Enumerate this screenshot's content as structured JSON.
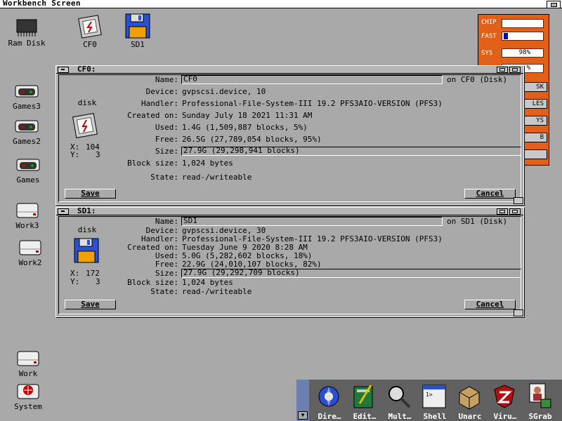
{
  "screen": {
    "title": "Workbench Screen"
  },
  "desktop_icons": [
    {
      "label": "Ram Disk"
    },
    {
      "label": "CF0"
    },
    {
      "label": "SD1"
    },
    {
      "label": "Games3"
    },
    {
      "label": "Games2"
    },
    {
      "label": "Games"
    },
    {
      "label": "Work3"
    },
    {
      "label": "Work2"
    },
    {
      "label": "Work"
    },
    {
      "label": "System"
    }
  ],
  "monitor": {
    "chip_label": "CHIP",
    "fast_label": "FAST",
    "sys_label": "SYS",
    "sys_value": "98%",
    "cpu_value": "%",
    "chip_fill": 0.0,
    "fast_fill": 0.12,
    "buttons": [
      "SK",
      "LES",
      "YS",
      "B",
      ""
    ]
  },
  "windows": [
    {
      "title": "CF0:",
      "icon_label": "disk",
      "x_label": "X:",
      "x_value": "104",
      "y_label": "Y:",
      "y_value": "3",
      "labels": {
        "name": "Name:",
        "device": "Device:",
        "handler": "Handler:",
        "created": "Created on:",
        "used": "Used:",
        "free": "Free:",
        "size": "Size:",
        "block": "Block size:",
        "state": "State:"
      },
      "name": "CF0",
      "on_text": "on CF0 (Disk)",
      "device": "gvpscsi.device, 10",
      "handler": "Professional-File-System-III 19.2 PFS3AIO-VERSION  (PFS3)",
      "created": "Sunday July 18 2021 11:31 AM",
      "used": "1.4G (1,509,887 blocks, 5%)",
      "free": "26.5G (27,789,054 blocks, 95%)",
      "size": "27.9G (29,298,941 blocks)",
      "block": "1,024 bytes",
      "state": "read-/writeable",
      "save": "Save",
      "cancel": "Cancel"
    },
    {
      "title": "SD1:",
      "icon_label": "disk",
      "x_label": "X:",
      "x_value": "172",
      "y_label": "Y:",
      "y_value": "3",
      "labels": {
        "name": "Name:",
        "device": "Device:",
        "handler": "Handler:",
        "created": "Created on:",
        "used": "Used:",
        "free": "Free:",
        "size": "Size:",
        "block": "Block size:",
        "state": "State:"
      },
      "name": "SD1",
      "on_text": "on SD1 (Disk)",
      "device": "gvpscsi.device, 30",
      "handler": "Professional-File-System-III 19.2 PFS3AIO-VERSION  (PFS3)",
      "created": "Tuesday June  9 2020 8:28 AM",
      "used": "5.0G (5,282,602 blocks, 18%)",
      "free": "22.9G (24,010,107 blocks, 82%)",
      "size": "27.9G (29,292,709 blocks)",
      "block": "1,024 bytes",
      "state": "read-/writeable",
      "save": "Save",
      "cancel": "Cancel"
    }
  ],
  "dock": [
    {
      "label": "Dire…",
      "icon": "directory-opus-icon"
    },
    {
      "label": "Edit…",
      "icon": "editor-icon"
    },
    {
      "label": "Mult…",
      "icon": "multiview-icon"
    },
    {
      "label": "Shell",
      "icon": "shell-icon"
    },
    {
      "label": "Unarc",
      "icon": "unarc-icon"
    },
    {
      "label": "Viru…",
      "icon": "virus-checker-icon"
    },
    {
      "label": "SGrab",
      "icon": "screengrab-icon"
    }
  ]
}
